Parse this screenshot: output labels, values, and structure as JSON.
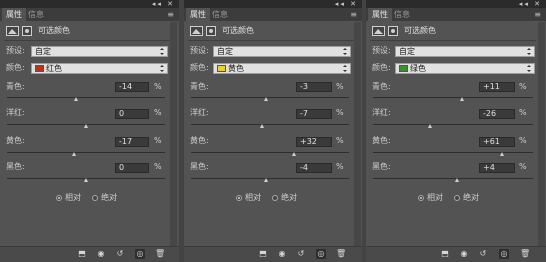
{
  "tabs": {
    "properties": "属性",
    "info": "信息"
  },
  "header": {
    "title": "可选颜色"
  },
  "labels": {
    "preset": "预设:",
    "colors": "颜色:",
    "cyan": "青色:",
    "magenta": "洋红:",
    "yellow": "黄色:",
    "black": "黑色:",
    "percent": "%"
  },
  "method": {
    "relative": "相对",
    "absolute": "绝对",
    "selected": "relative"
  },
  "panels": [
    {
      "preset": "自定",
      "color_name": "红色",
      "color_hex": "#d8260f",
      "cyan": "-14",
      "magenta": "0",
      "yellow": "-17",
      "black": "0"
    },
    {
      "preset": "自定",
      "color_name": "黄色",
      "color_hex": "#f2d600",
      "cyan": "-3",
      "magenta": "-7",
      "yellow": "+32",
      "black": "-4"
    },
    {
      "preset": "自定",
      "color_name": "绿色",
      "color_hex": "#2c9a1e",
      "cyan": "+11",
      "magenta": "-26",
      "yellow": "+61",
      "black": "+4"
    }
  ],
  "footer_icons": [
    "clip-to-layer-icon",
    "view-previous-state-icon",
    "reset-icon",
    "visibility-eye-icon",
    "delete-icon"
  ],
  "colors": {
    "panel_bg": "#535353",
    "field_bg": "#3a3a3a",
    "dropdown_bg": "#e1e1e1"
  }
}
